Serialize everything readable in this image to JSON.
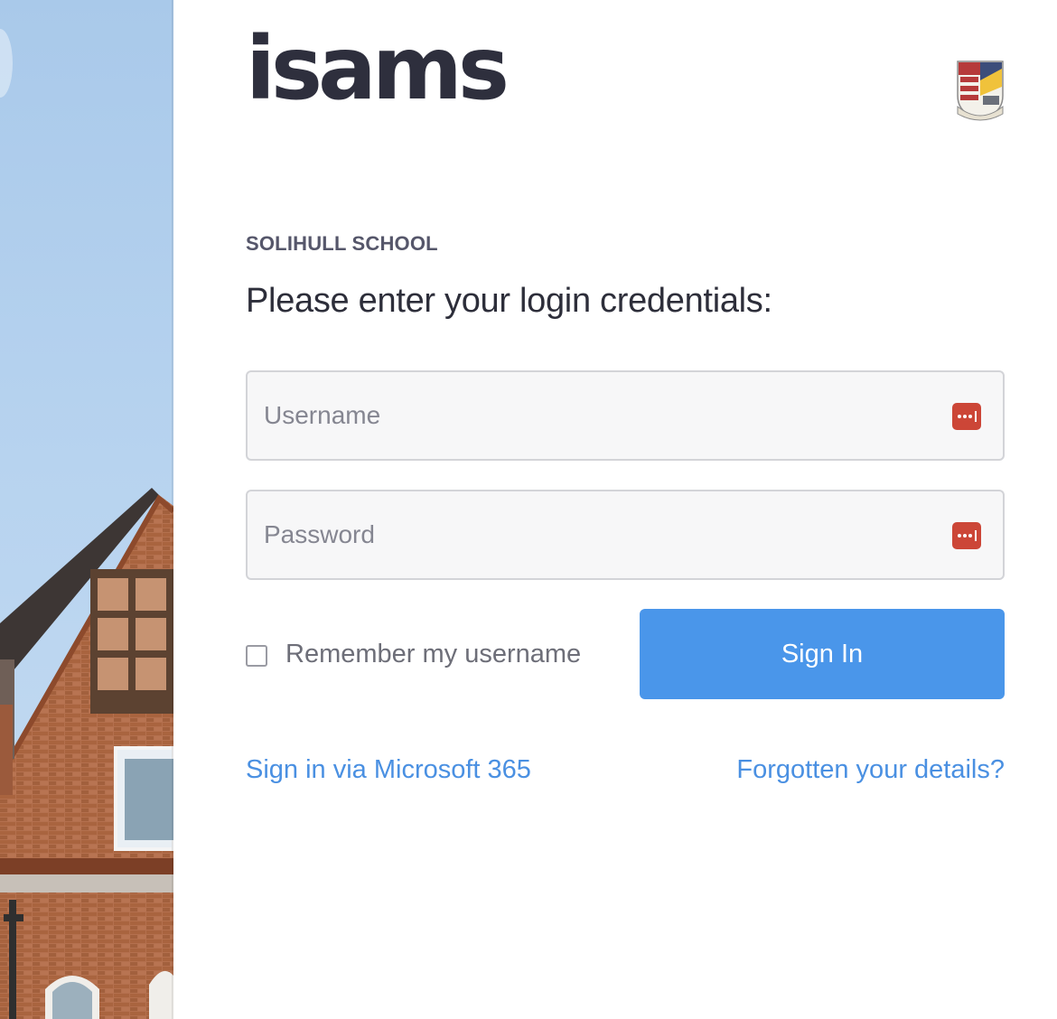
{
  "brand": {
    "logo_text": "isams",
    "crest_icon": "school-crest-icon"
  },
  "school_name": "SOLIHULL SCHOOL",
  "heading": "Please enter your login credentials:",
  "form": {
    "username_placeholder": "Username",
    "username_value": "",
    "password_placeholder": "Password",
    "password_value": "",
    "password_manager_icon": "password-manager-icon",
    "remember_label": "Remember my username",
    "remember_checked": false,
    "signin_label": "Sign In"
  },
  "links": {
    "microsoft": "Sign in via Microsoft 365",
    "forgot": "Forgotten your details?"
  },
  "colors": {
    "brand_text": "#2e2f3d",
    "primary_button": "#4a96ea",
    "link": "#4a90e2",
    "password_manager": "#cc4637"
  }
}
